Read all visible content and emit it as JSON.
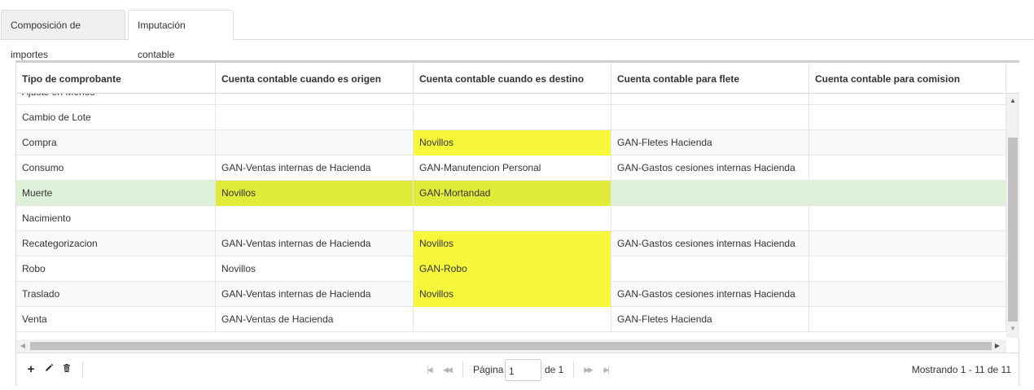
{
  "tabs": [
    {
      "label": "Composición de importes"
    },
    {
      "label": "Imputación contable"
    }
  ],
  "columns": [
    "Tipo de comprobante",
    "Cuenta contable cuando es origen",
    "Cuenta contable cuando es destino",
    "Cuenta contable para flete",
    "Cuenta contable para comision"
  ],
  "rows": [
    [
      "Ajuste en Menos",
      "",
      "",
      "",
      ""
    ],
    [
      "Cambio de Lote",
      "",
      "",
      "",
      ""
    ],
    [
      "Compra",
      "",
      "Novillos",
      "GAN-Fletes Hacienda",
      ""
    ],
    [
      "Consumo",
      "GAN-Ventas internas de Hacienda",
      "GAN-Manutencion Personal",
      "GAN-Gastos cesiones internas Hacienda",
      ""
    ],
    [
      "Muerte",
      "Novillos",
      "GAN-Mortandad",
      "",
      ""
    ],
    [
      "Nacimiento",
      "",
      "",
      "",
      ""
    ],
    [
      "Recategorizacion",
      "GAN-Ventas internas de Hacienda",
      "Novillos",
      "GAN-Gastos cesiones internas Hacienda",
      ""
    ],
    [
      "Robo",
      "Novillos",
      "GAN-Robo",
      "",
      ""
    ],
    [
      "Traslado",
      "GAN-Ventas internas de Hacienda",
      "Novillos",
      "GAN-Gastos cesiones internas Hacienda",
      ""
    ],
    [
      "Venta",
      "GAN-Ventas de Hacienda",
      "",
      "GAN-Fletes Hacienda",
      ""
    ]
  ],
  "selected_row": "Muerte",
  "highlight_color": "#f7f73b",
  "selected_row_color": "#dff0d8",
  "pager": {
    "page_label": "Página",
    "page_value": "1",
    "of_label": "de 1",
    "showing": "Mostrando 1 - 11 de 11"
  },
  "icons": {
    "add": "plus-icon",
    "edit": "pencil-icon",
    "delete": "trash-icon",
    "first": "first-page-icon",
    "prev": "prev-page-icon",
    "next": "next-page-icon",
    "last": "last-page-icon"
  }
}
